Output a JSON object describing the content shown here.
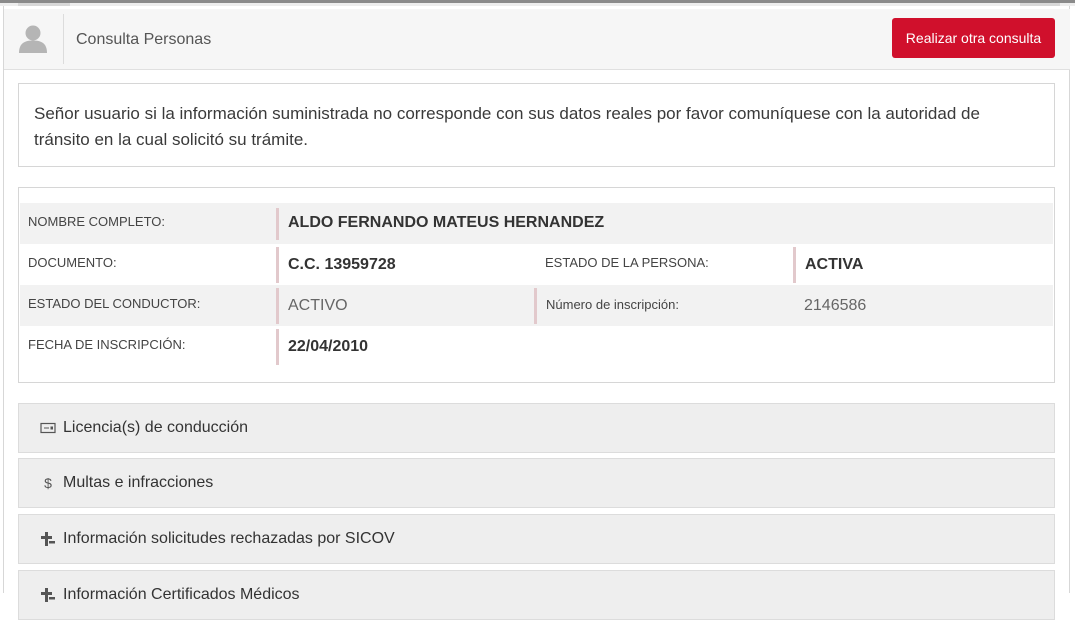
{
  "header": {
    "title": "Consulta Personas",
    "action_button": "Realizar otra consulta"
  },
  "notice": {
    "text": "Señor usuario si la información suministrada no corresponde con sus datos reales por favor comuníquese con la autoridad de tránsito en la cual solicitó su trámite."
  },
  "person": {
    "nombre_label": "NOMBRE COMPLETO:",
    "nombre_value": "ALDO FERNANDO MATEUS HERNANDEZ",
    "documento_label": "DOCUMENTO:",
    "documento_value": "C.C. 13959728",
    "estado_persona_label": "ESTADO DE LA PERSONA:",
    "estado_persona_value": "ACTIVA",
    "estado_conductor_label": "ESTADO DEL CONDUCTOR:",
    "estado_conductor_value": "ACTIVO",
    "num_inscripcion_label": "Número de inscripción:",
    "num_inscripcion_value": "2146586",
    "fecha_inscripcion_label": "FECHA DE INSCRIPCIÓN:",
    "fecha_inscripcion_value": "22/04/2010"
  },
  "accordion": [
    {
      "label": "Licencia(s) de conducción",
      "icon": "license-card-icon"
    },
    {
      "label": "Multas e infracciones",
      "icon": "dollar-icon"
    },
    {
      "label": "Información solicitudes rechazadas por SICOV",
      "icon": "plus-minus-icon"
    },
    {
      "label": "Información Certificados Médicos",
      "icon": "plus-minus-icon"
    }
  ],
  "colors": {
    "accent_red": "#d0102c",
    "value_border": "#e2c9cc"
  }
}
